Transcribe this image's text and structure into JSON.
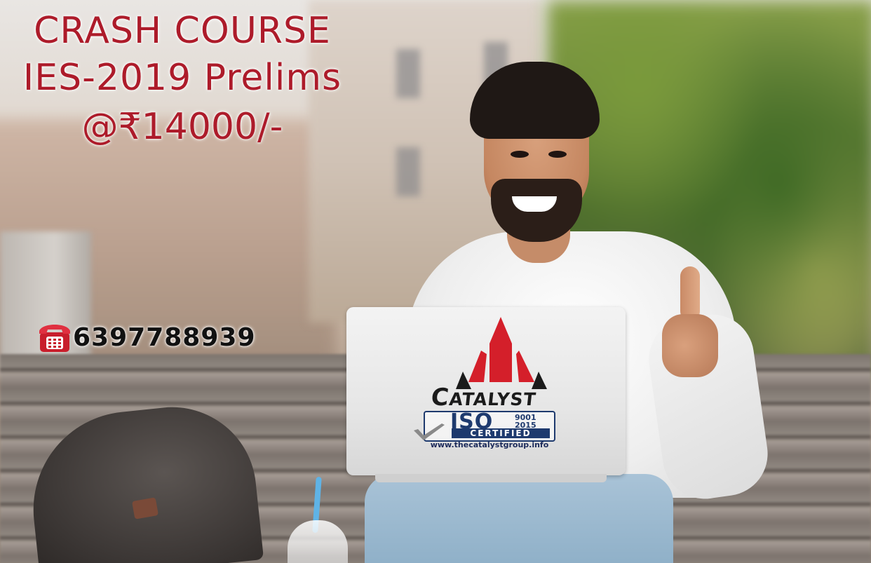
{
  "headline": {
    "line1": "CRASH COURSE",
    "line2": "IES-2019 Prelims",
    "line3": "@₹14000/-"
  },
  "contact": {
    "phone_icon": "telephone-icon",
    "phone_number": "6397788939"
  },
  "brand": {
    "logo_icon": "rocket-tower-icon",
    "name_initial": "C",
    "name_rest": "ATALYST",
    "iso_label": "ISO",
    "iso_year_1": "9001",
    "iso_year_2": "2015",
    "iso_certified": "CERTIFIED",
    "website": "www.thecatalystgroup.info"
  },
  "colors": {
    "headline_red": "#ad1b2a",
    "logo_red": "#d41f2a",
    "logo_navy": "#1e3a6e"
  }
}
